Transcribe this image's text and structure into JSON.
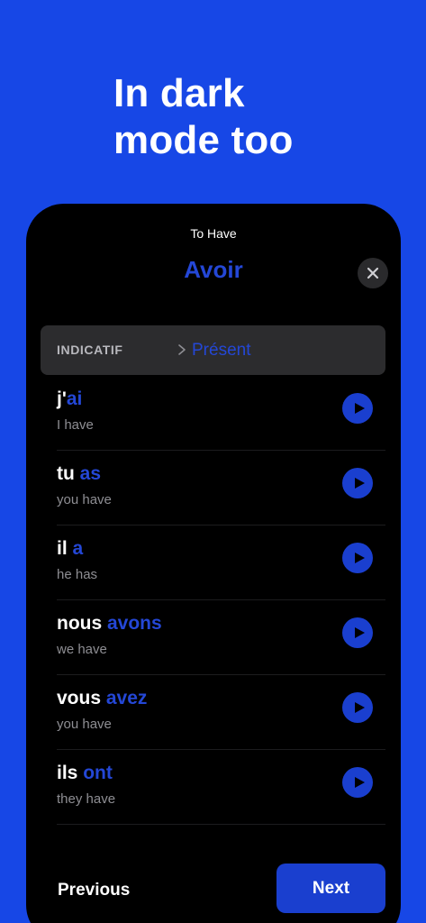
{
  "hero": {
    "line1": "In dark",
    "line2": "mode too"
  },
  "colors": {
    "background": "#1747E6",
    "accent": "#2447D6",
    "button": "#1A3FCF",
    "panel": "#000000"
  },
  "header": {
    "subtitle": "To Have",
    "title": "Avoir",
    "close_icon": "close-icon"
  },
  "tense": {
    "mood": "INDICATIF",
    "separator_icon": "chevron-right-icon",
    "name": "Présent"
  },
  "conjugations": [
    {
      "pronoun": "j'",
      "verb": "ai",
      "translation": "I have"
    },
    {
      "pronoun": "tu ",
      "verb": "as",
      "translation": "you have"
    },
    {
      "pronoun": "il ",
      "verb": "a",
      "translation": "he has"
    },
    {
      "pronoun": "nous ",
      "verb": "avons",
      "translation": "we have"
    },
    {
      "pronoun": "vous ",
      "verb": "avez",
      "translation": "you have"
    },
    {
      "pronoun": "ils ",
      "verb": "ont",
      "translation": "they have"
    }
  ],
  "footer": {
    "previous_label": "Previous",
    "next_label": "Next"
  }
}
